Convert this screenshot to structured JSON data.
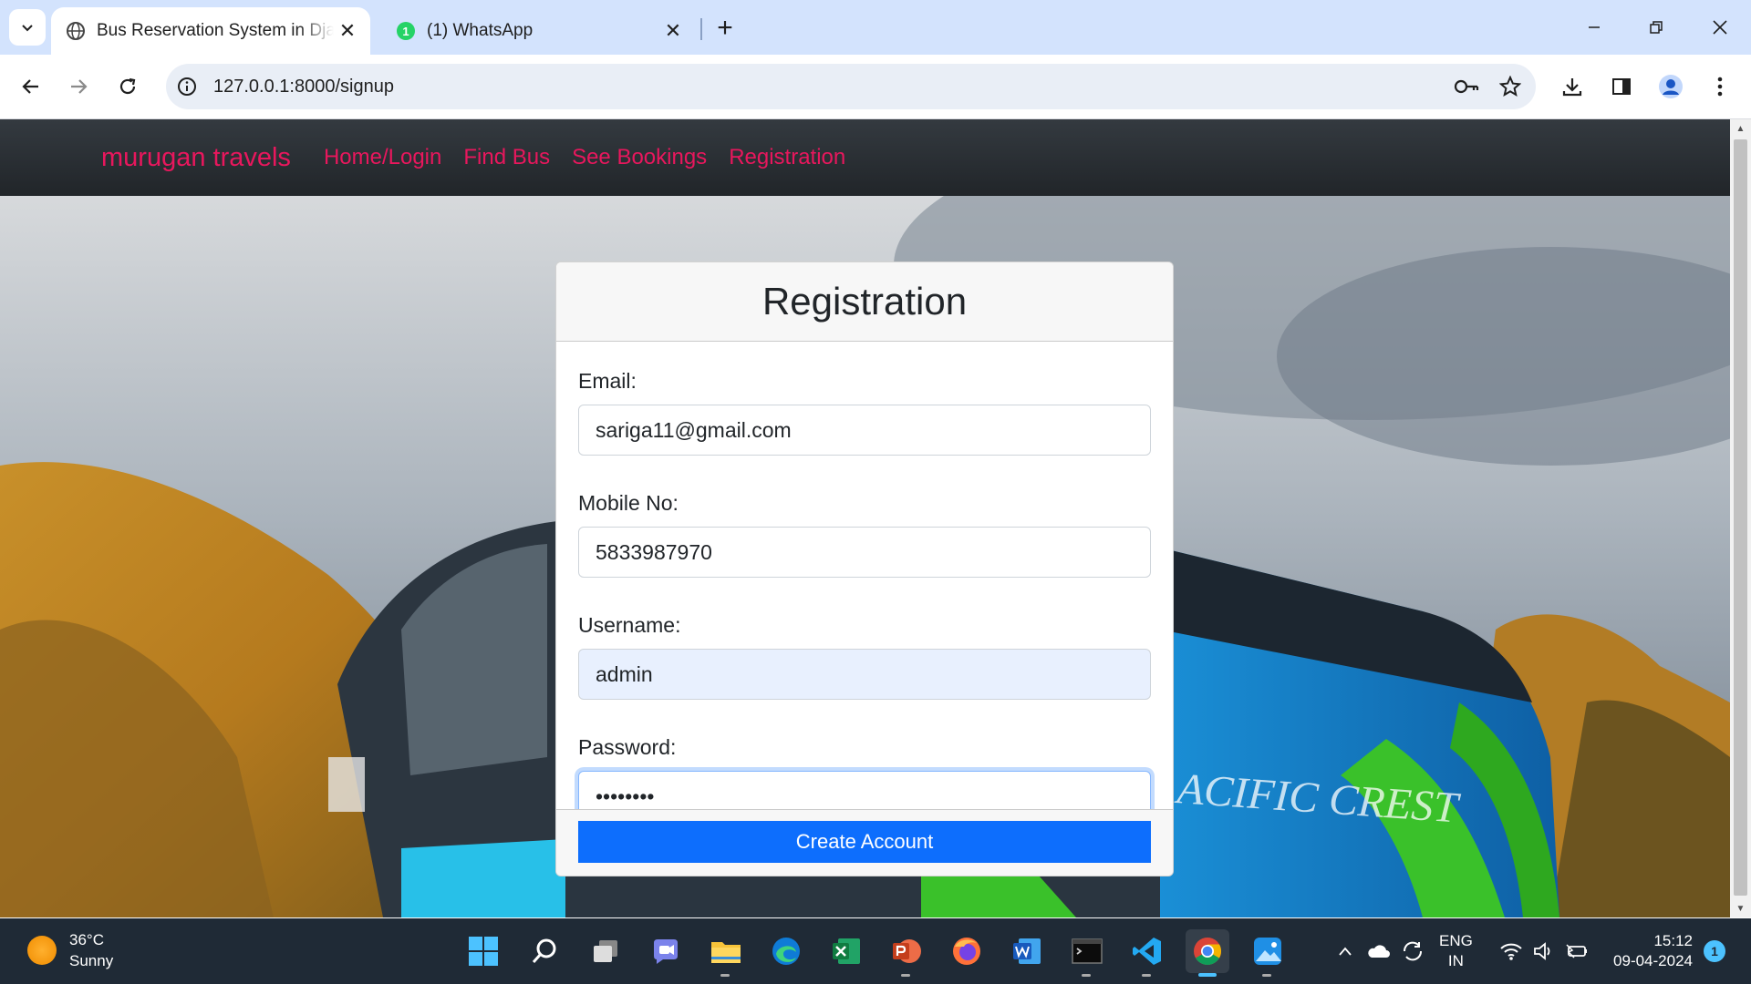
{
  "browser": {
    "tabs": [
      {
        "title": "Bus Reservation System in Dja",
        "favicon": "globe-icon",
        "active": true
      },
      {
        "title": "(1) WhatsApp",
        "favicon": "whatsapp-icon",
        "badge": "1",
        "active": false
      }
    ],
    "url": "127.0.0.1:8000/signup"
  },
  "navbar": {
    "brand": "murugan travels",
    "links": [
      "Home/Login",
      "Find Bus",
      "See Bookings",
      "Registration"
    ]
  },
  "form": {
    "title": "Registration",
    "fields": [
      {
        "label": "Email:",
        "value": "sariga11@gmail.com"
      },
      {
        "label": "Mobile No:",
        "value": "5833987970"
      },
      {
        "label": "Username:",
        "value": "admin"
      },
      {
        "label": "Password:",
        "value": "••••••••"
      }
    ],
    "submit_label": "Create Account"
  },
  "background_text": "ACIFIC CREST",
  "taskbar": {
    "weather": {
      "temp": "36°C",
      "condition": "Sunny"
    },
    "lang": {
      "line1": "ENG",
      "line2": "IN"
    },
    "clock": {
      "time": "15:12",
      "date": "09-04-2024"
    },
    "notification_count": "1"
  },
  "colors": {
    "brand_accent": "#e8175d",
    "primary_button": "#0d6efd",
    "navbar_bg": "#212529"
  }
}
